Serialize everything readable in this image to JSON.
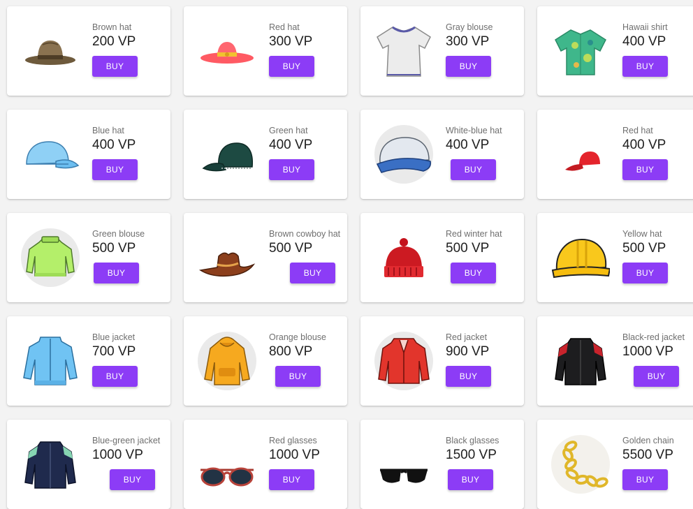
{
  "products": [
    {
      "name": "Brown hat",
      "price": "200 VP",
      "button": "BUY",
      "icon": "brown-hat-icon"
    },
    {
      "name": "Red hat",
      "price": "300 VP",
      "button": "BUY",
      "icon": "red-sun-hat-icon"
    },
    {
      "name": "Gray blouse",
      "price": "300 VP",
      "button": "BUY",
      "icon": "gray-blouse-icon"
    },
    {
      "name": "Hawaii shirt",
      "price": "400 VP",
      "button": "BUY",
      "icon": "hawaii-shirt-icon"
    },
    {
      "name": "Blue hat",
      "price": "400 VP",
      "button": "BUY",
      "icon": "blue-cap-icon"
    },
    {
      "name": "Green hat",
      "price": "400 VP",
      "button": "BUY",
      "icon": "green-cap-icon"
    },
    {
      "name": "White-blue hat",
      "price": "400 VP",
      "button": "BUY",
      "icon": "white-blue-cap-icon"
    },
    {
      "name": "Red hat",
      "price": "400 VP",
      "button": "BUY",
      "icon": "red-cap-icon"
    },
    {
      "name": "Green blouse",
      "price": "500 VP",
      "button": "BUY",
      "icon": "green-sweater-icon"
    },
    {
      "name": "Brown cowboy hat",
      "price": "500 VP",
      "button": "BUY",
      "icon": "cowboy-hat-icon"
    },
    {
      "name": "Red winter hat",
      "price": "500 VP",
      "button": "BUY",
      "icon": "winter-hat-icon"
    },
    {
      "name": "Yellow hat",
      "price": "500 VP",
      "button": "BUY",
      "icon": "hard-hat-icon"
    },
    {
      "name": "Blue jacket",
      "price": "700 VP",
      "button": "BUY",
      "icon": "blue-jacket-icon"
    },
    {
      "name": "Orange blouse",
      "price": "800 VP",
      "button": "BUY",
      "icon": "orange-hoodie-icon"
    },
    {
      "name": "Red jacket",
      "price": "900 VP",
      "button": "BUY",
      "icon": "red-jacket-icon"
    },
    {
      "name": "Black-red jacket",
      "price": "1000 VP",
      "button": "BUY",
      "icon": "black-red-jacket-icon"
    },
    {
      "name": "Blue-green jacket",
      "price": "1000 VP",
      "button": "BUY",
      "icon": "blue-green-jacket-icon"
    },
    {
      "name": "Red glasses",
      "price": "1000 VP",
      "button": "BUY",
      "icon": "red-glasses-icon"
    },
    {
      "name": "Black glasses",
      "price": "1500 VP",
      "button": "BUY",
      "icon": "black-glasses-icon"
    },
    {
      "name": "Golden chain",
      "price": "5500 VP",
      "button": "BUY",
      "icon": "gold-chain-icon"
    }
  ],
  "colors": {
    "accent": "#8c3cf6",
    "card": "#ffffff",
    "background": "#f3f3f3"
  }
}
